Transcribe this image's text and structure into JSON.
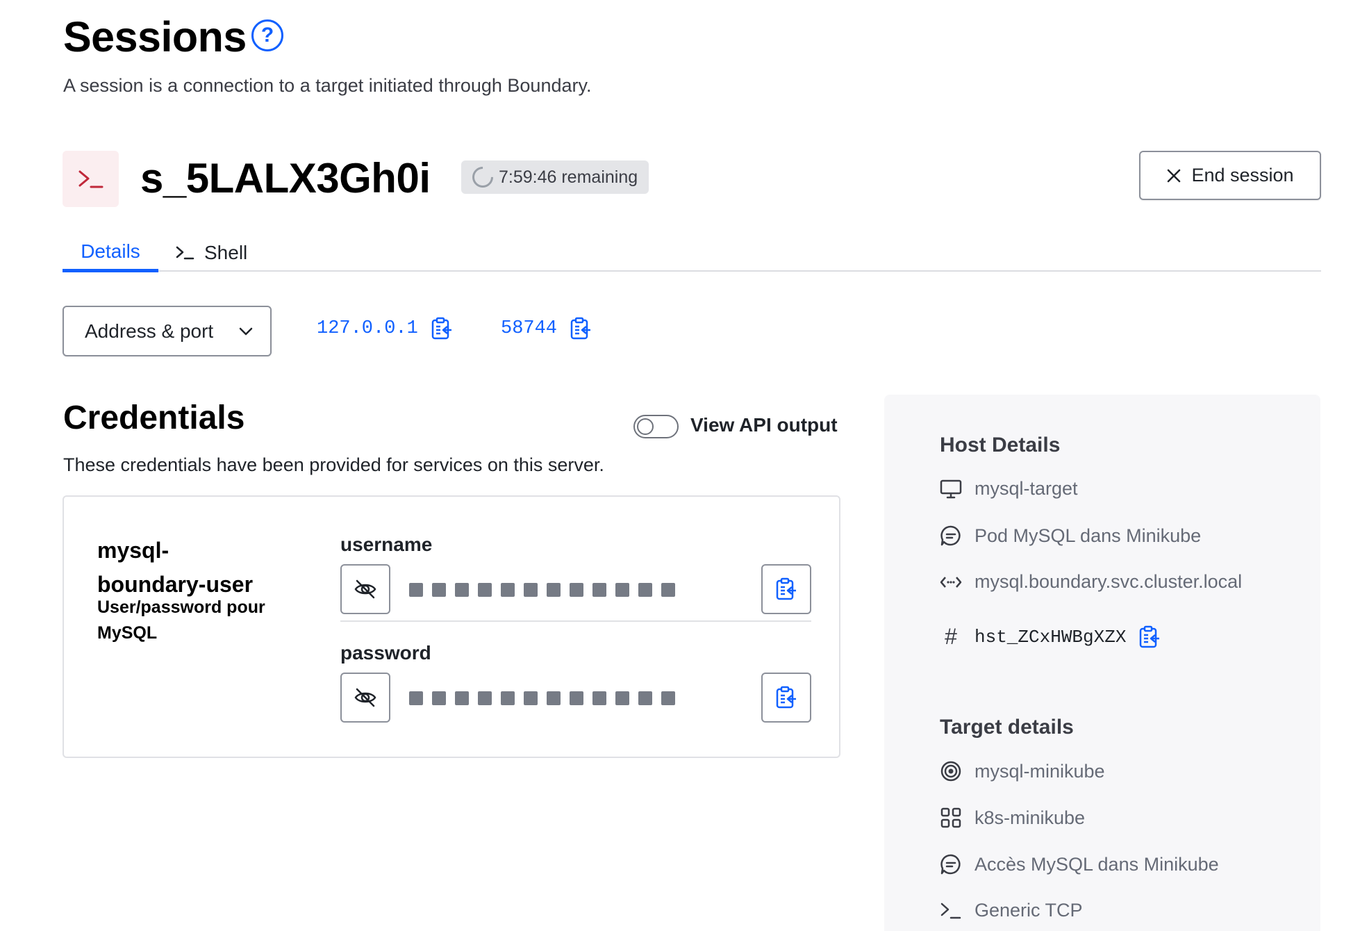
{
  "header": {
    "title": "Sessions",
    "help_icon": "question-circle-icon",
    "description": "A session is a connection to a target initiated through Boundary."
  },
  "session": {
    "icon": "terminal-icon",
    "id": "s_5LALX3Gh0i",
    "timer_text": "7:59:46 remaining",
    "end_label": "End session"
  },
  "tabs": [
    {
      "label": "Details",
      "active": true
    },
    {
      "label": "Shell",
      "active": false
    }
  ],
  "connection": {
    "select_label": "Address & port",
    "address": "127.0.0.1",
    "port": "58744"
  },
  "credentials": {
    "title": "Credentials",
    "description": "These credentials have been provided for services on this server.",
    "toggle_label": "View API output",
    "toggle_on": false,
    "item": {
      "name": "mysql-\nboundary-user",
      "description": "User/password pour MySQL",
      "fields": [
        {
          "label": "username",
          "masked": true
        },
        {
          "label": "password",
          "masked": true
        }
      ]
    }
  },
  "host_details": {
    "title": "Host Details",
    "name": "mysql-target",
    "description": "Pod MySQL dans Minikube",
    "address": "mysql.boundary.svc.cluster.local",
    "id": "hst_ZCxHWBgXZX"
  },
  "target_details": {
    "title": "Target details",
    "name": "mysql-minikube",
    "scope": "k8s-minikube",
    "description": "Accès MySQL dans Minikube",
    "type": "Generic TCP"
  },
  "colors": {
    "accent": "#1060ff",
    "session_icon_bg": "#fbeef0",
    "session_icon_fg": "#c0283a",
    "side_panel_bg": "#f7f7f9"
  }
}
